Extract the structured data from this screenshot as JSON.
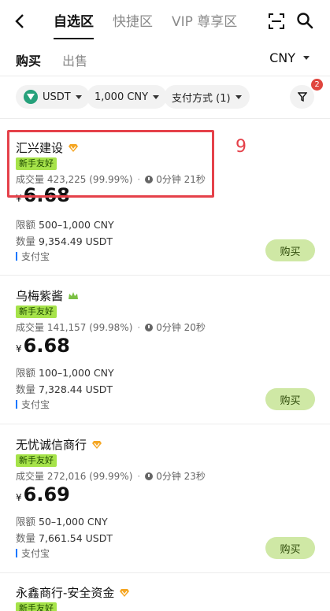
{
  "header": {
    "tabs": [
      {
        "label": "自选区",
        "active": true
      },
      {
        "label": "快捷区",
        "active": false
      },
      {
        "label": "VIP 尊享区",
        "active": false
      }
    ]
  },
  "subnav": {
    "buy_label": "购买",
    "sell_label": "出售",
    "currency": "CNY"
  },
  "filters": {
    "coin": "USDT",
    "amount": "1,000 CNY",
    "payment": "支付方式 (1)",
    "badge_count": "2"
  },
  "annotation": {
    "marker_label": "9"
  },
  "listings": [
    {
      "name": "汇兴建设",
      "badge": "新手友好",
      "stats": "成交量 423,225 (99.99%)",
      "time": "0分钟 21秒",
      "currency_symbol": "¥",
      "price": "6.68",
      "limit_label": "限额",
      "limit": "500–1,000 CNY",
      "amount_label": "数量",
      "amount": "9,354.49 USDT",
      "payment": "支付宝",
      "buy_label": "购买"
    },
    {
      "name": "乌梅紫酱",
      "badge": "新手友好",
      "stats": "成交量 141,157 (99.98%)",
      "time": "0分钟 20秒",
      "currency_symbol": "¥",
      "price": "6.68",
      "limit_label": "限额",
      "limit": "100–1,000 CNY",
      "amount_label": "数量",
      "amount": "7,328.44 USDT",
      "payment": "支付宝",
      "buy_label": "购买"
    },
    {
      "name": "无忧诚信商行",
      "badge": "新手友好",
      "stats": "成交量 272,016 (99.99%)",
      "time": "0分钟 23秒",
      "currency_symbol": "¥",
      "price": "6.69",
      "limit_label": "限额",
      "limit": "50–1,000 CNY",
      "amount_label": "数量",
      "amount": "7,661.54 USDT",
      "payment": "支付宝",
      "buy_label": "购买"
    },
    {
      "name": "永鑫商行-安全资金",
      "badge": "新手友好"
    }
  ],
  "colors": {
    "accent_green": "#a6e34a",
    "buy_button_bg": "#cfe8a5",
    "highlight_red": "#e5414a",
    "merchant_gold": "#f5a623",
    "merchant_crown_green": "#7bc043"
  }
}
